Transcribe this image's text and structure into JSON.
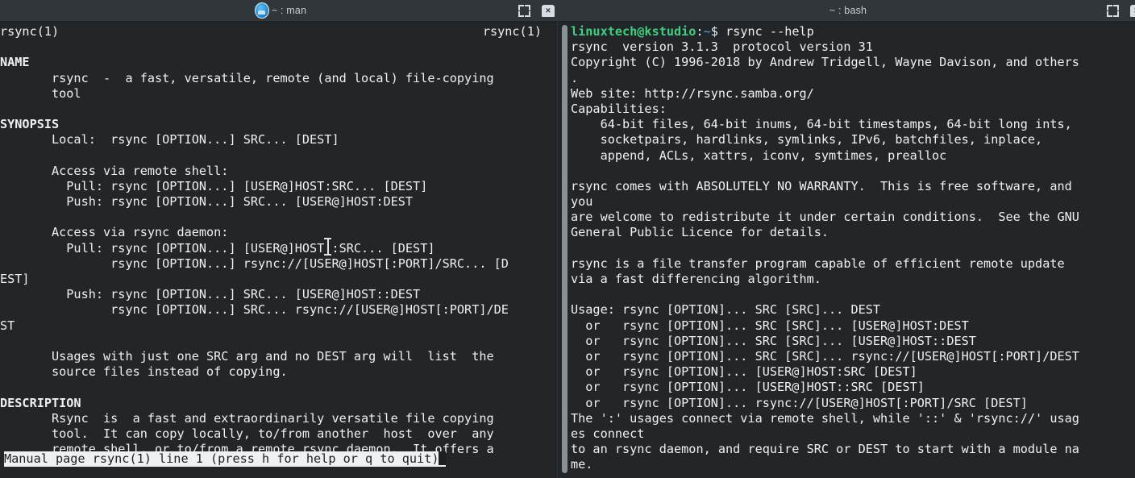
{
  "window": {
    "left_titlebar": {
      "tab_label": "~ : man",
      "icon": "konsole-app-icon",
      "maximize_label": "⬜",
      "close_label": "×"
    },
    "right_titlebar": {
      "tab_label": "~ : bash",
      "maximize_label": "⬜",
      "close_label": "×"
    }
  },
  "left_pane": {
    "header_left": "rsync(1)",
    "header_right": "rsync(1)",
    "lines": [
      "",
      "NAME",
      "       rsync  -  a fast, versatile, remote (and local) file-copying",
      "       tool",
      "",
      "SYNOPSIS",
      "       Local:  rsync [OPTION...] SRC... [DEST]",
      "",
      "       Access via remote shell:",
      "         Pull: rsync [OPTION...] [USER@]HOST:SRC... [DEST]",
      "         Push: rsync [OPTION...] SRC... [USER@]HOST:DEST",
      "",
      "       Access via rsync daemon:",
      "         Pull: rsync [OPTION...] [USER@]HOST::SRC... [DEST]",
      "               rsync [OPTION...] rsync://[USER@]HOST[:PORT]/SRC... [D",
      "EST]",
      "         Push: rsync [OPTION...] SRC... [USER@]HOST::DEST",
      "               rsync [OPTION...] SRC... rsync://[USER@]HOST[:PORT]/DE",
      "ST",
      "",
      "       Usages with just one SRC arg and no DEST arg will  list  the",
      "       source files instead of copying.",
      "",
      "DESCRIPTION",
      "       Rsync  is  a fast and extraordinarily versatile file copying",
      "       tool.  It can copy locally, to/from another  host  over  any",
      "       remote shell, or to/from a remote rsync daemon.  It offers a"
    ],
    "bold_lines": [
      1,
      5,
      23
    ],
    "statusbar": "Manual page rsync(1) line 1 (press h for help or q to quit)"
  },
  "right_pane": {
    "prompt": {
      "user_host": "linuxtech@kstudio",
      "colon": ":",
      "path": "~",
      "sigil": "$ ",
      "command": "rsync --help"
    },
    "lines": [
      "rsync  version 3.1.3  protocol version 31",
      "Copyright (C) 1996-2018 by Andrew Tridgell, Wayne Davison, and others",
      ".",
      "Web site: http://rsync.samba.org/",
      "Capabilities:",
      "    64-bit files, 64-bit inums, 64-bit timestamps, 64-bit long ints,",
      "    socketpairs, hardlinks, symlinks, IPv6, batchfiles, inplace,",
      "    append, ACLs, xattrs, iconv, symtimes, prealloc",
      "",
      "rsync comes with ABSOLUTELY NO WARRANTY.  This is free software, and",
      "you",
      "are welcome to redistribute it under certain conditions.  See the GNU",
      "General Public Licence for details.",
      "",
      "rsync is a file transfer program capable of efficient remote update",
      "via a fast differencing algorithm.",
      "",
      "Usage: rsync [OPTION]... SRC [SRC]... DEST",
      "  or   rsync [OPTION]... SRC [SRC]... [USER@]HOST:DEST",
      "  or   rsync [OPTION]... SRC [SRC]... [USER@]HOST::DEST",
      "  or   rsync [OPTION]... SRC [SRC]... rsync://[USER@]HOST[:PORT]/DEST",
      "  or   rsync [OPTION]... [USER@]HOST:SRC [DEST]",
      "  or   rsync [OPTION]... [USER@]HOST::SRC [DEST]",
      "  or   rsync [OPTION]... rsync://[USER@]HOST[:PORT]/SRC [DEST]",
      "The ':' usages connect via remote shell, while '::' & 'rsync://' usag",
      "es connect",
      "to an rsync daemon, and require SRC or DEST to start with a module na",
      "me."
    ]
  },
  "colors": {
    "terminal_bg": "#232629",
    "titlebar_bg": "#31363b",
    "foreground": "#eff0f1",
    "prompt_green": "#3fd07f",
    "prompt_blue": "#3daee9",
    "scrollbar": "#8a9196",
    "statusbar_bg": "#eff0f1",
    "statusbar_fg": "#1c1f21"
  }
}
